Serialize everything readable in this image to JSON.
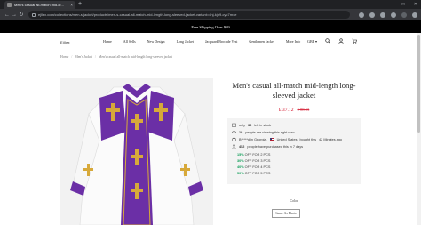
{
  "browser": {
    "tab_title": "Men's casual all-match mid-le...",
    "tab_close": "×",
    "new_tab": "+",
    "url": "ejllex.com/collections/men-s-jacket/products/men-s-casual-all-match-mid-length-long-sleeved-jacket-variant=4hj-kjh9-cyc7m4e",
    "back": "←",
    "forward": "→",
    "reload": "↻",
    "win_min": "─",
    "win_max": "□",
    "win_close": "✕"
  },
  "announcement": "Free Shipping Over $69",
  "header": {
    "logo": "Ejllex",
    "menu": [
      "Home",
      "All Sells",
      "New Design",
      "Long Jacket",
      "Jacquard Brocade Vest",
      "Gentlemen Jacket",
      "More Info"
    ],
    "currency": "GBP ▾",
    "icons": [
      "search-icon",
      "user-icon",
      "cart-icon"
    ]
  },
  "breadcrumb": [
    "Home",
    "Men's Jacket",
    "Men's casual all-match mid-length long-sleeved jacket"
  ],
  "product": {
    "title": "Men's casual all-match mid-length long-sleeved jacket",
    "price_now": "£ 37.12",
    "price_was": "£ 88.53",
    "colors": {
      "accent": "#d0021b",
      "offer": "#0f9d58",
      "robe_purple": "#6b2fa6",
      "robe_gold": "#d7a93a"
    }
  },
  "promo": {
    "stock_pre": "only",
    "stock_num": "36",
    "stock_post": "left in stock",
    "viewers_num": "10",
    "viewers_text": "people are viewing this right now",
    "recent_name": "B*****d in Georgia,",
    "recent_country": "United States",
    "recent_text": "bought this",
    "recent_time": "42 Minutes ago",
    "bought_num": "452",
    "bought_text": "people have purchased this in 7 days",
    "offers": [
      {
        "pct": "15%",
        "text": "OFF FOR 2 PCS"
      },
      {
        "pct": "30%",
        "text": "OFF FOR 3 PCS"
      },
      {
        "pct": "40%",
        "text": "OFF FOR 4 PCS"
      },
      {
        "pct": "50%",
        "text": "OFF FOR 5 PCS"
      }
    ]
  },
  "color_label": "Color",
  "photo_button": "Same As Photo"
}
